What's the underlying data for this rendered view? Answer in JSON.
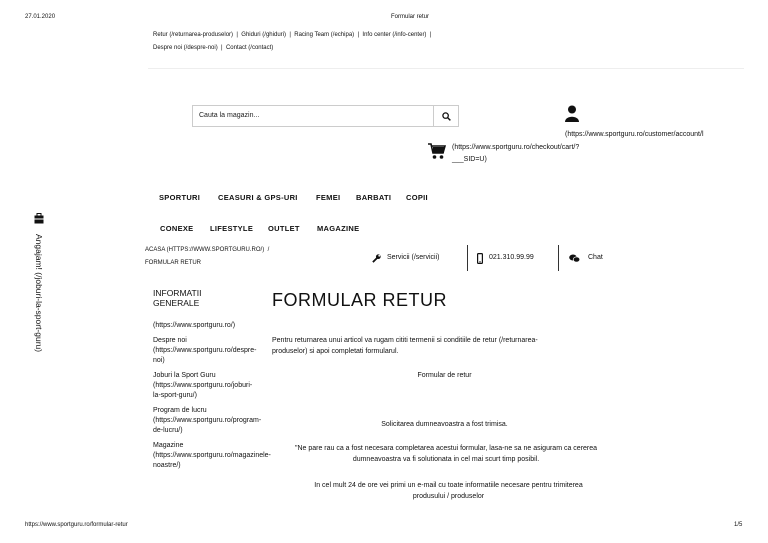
{
  "print_header": {
    "date": "27.01.2020",
    "doc_title": "Formular retur"
  },
  "top_links": {
    "line1": [
      "Retur (/returnarea-produselor)",
      "Ghiduri (/ghiduri)",
      "Racing Team (/echipa)",
      "Info center (/info-center)"
    ],
    "line2": [
      "Despre noi (/despre-noi)",
      "Contact (/contact)"
    ],
    "separator": "|"
  },
  "search": {
    "placeholder": "Cauta la magazin..."
  },
  "account": {
    "link_text": "(https://www.sportguru.ro/customer/account/l"
  },
  "cart": {
    "link_line1": "(https://www.sportguru.ro/checkout/cart/?",
    "link_line2": "___SID=U)"
  },
  "side_vertical": {
    "text": "Angajam! (/joburi-la-sport-guru)"
  },
  "nav": {
    "row1": [
      "SPORTURI",
      "CEASURI & GPS-URI",
      "FEMEI",
      "BARBATI",
      "COPII"
    ],
    "row2": [
      "CONEXE",
      "LIFESTYLE",
      "OUTLET",
      "MAGAZINE"
    ]
  },
  "breadcrumb": {
    "home": "ACASA (HTTPS://WWW.SPORTGURU.RO/)",
    "sep": "/",
    "current": "FORMULAR RETUR"
  },
  "service_bar": {
    "services": "Servicii (/servicii)",
    "phone": "021.310.99.99",
    "chat": "Chat"
  },
  "sidebar": {
    "heading_line1": "INFORMATII",
    "heading_line2": "GENERALE",
    "lines": [
      "(https://www.sportguru.ro/)",
      "Despre noi",
      "(https://www.sportguru.ro/despre-",
      "noi)",
      "Joburi la Sport Guru",
      "(https://www.sportguru.ro/joburi-",
      "la-sport-guru/)",
      "Program de lucru",
      "(https://www.sportguru.ro/program-",
      "de-lucru/)",
      "Magazine",
      "(https://www.sportguru.ro/magazinele-",
      "noastre/)"
    ]
  },
  "main": {
    "title": "FORMULAR RETUR",
    "intro_line1": "Pentru returnarea unui articol va rugam cititi termenii si conditiile de retur (/returnarea-",
    "intro_line2": "produselor) si apoi completati formularul.",
    "form_label": "Formular de retur",
    "success": "Solicitarea dumneavoastra a fost trimisa.",
    "note1_line1": "\"Ne pare rau ca a fost necesara completarea acestui formular, lasa-ne sa ne asiguram ca cererea",
    "note1_line2": "dumneavoastra va fi solutionata in cel mai scurt timp posibil.",
    "note2_line1": "In cel mult 24 de ore vei primi un e-mail cu toate informatiile necesare pentru trimiterea",
    "note2_line2": "produsului / produselor"
  },
  "print_footer": {
    "url": "https://www.sportguru.ro/formular-retur",
    "page": "1/5"
  }
}
